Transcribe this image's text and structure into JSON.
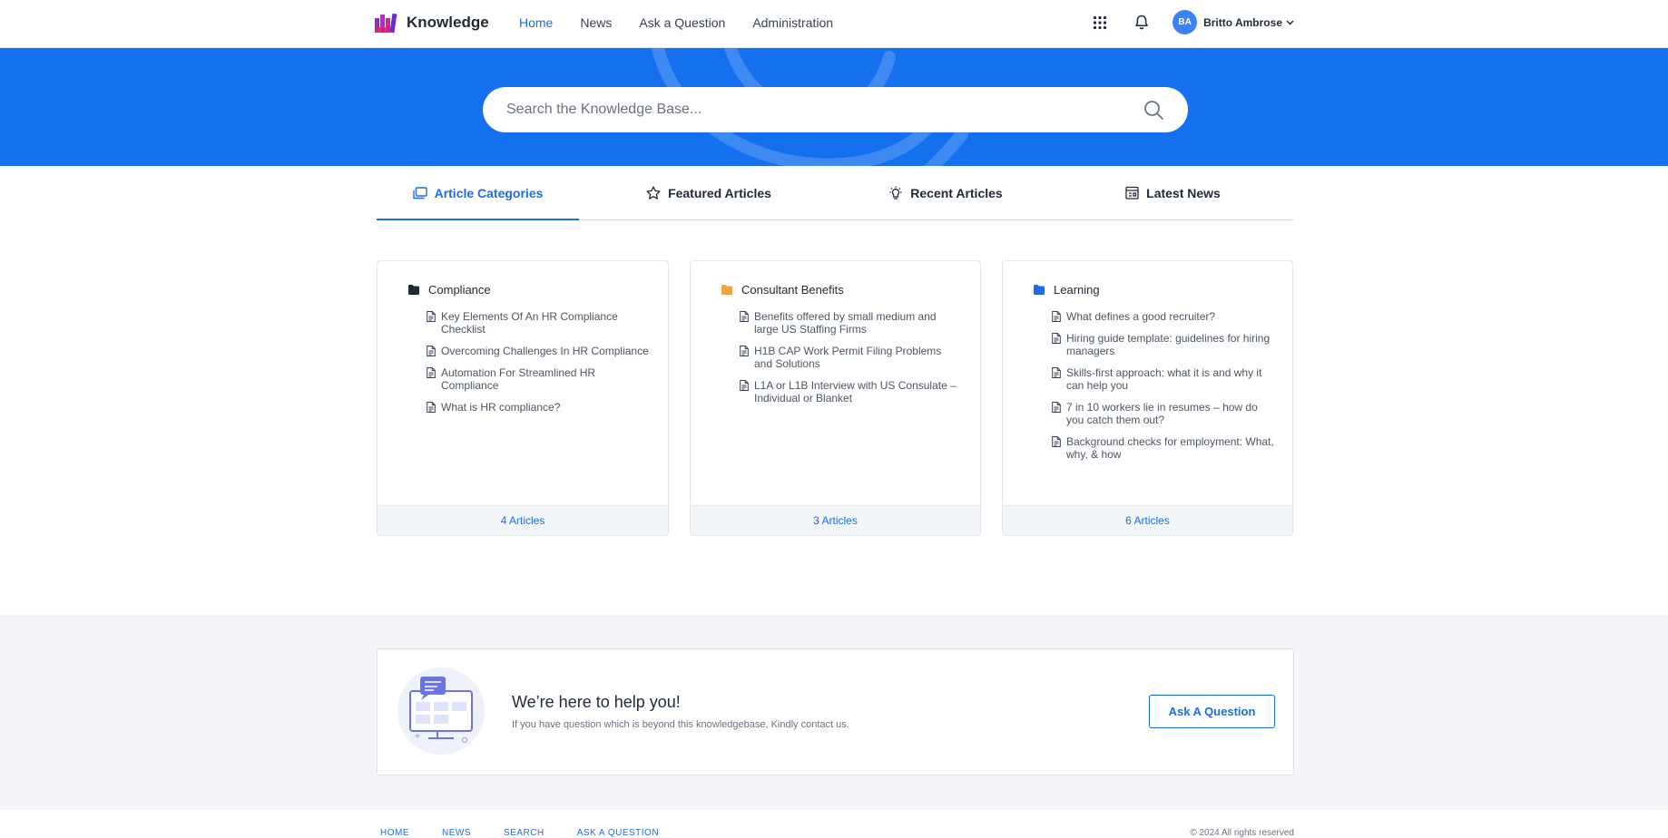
{
  "header": {
    "brand": "Knowledge",
    "nav": [
      "Home",
      "News",
      "Ask a Question",
      "Administration"
    ],
    "active_nav": "Home",
    "user": {
      "initials": "BA",
      "name": "Britto Ambrose"
    }
  },
  "hero": {
    "search_placeholder": "Search the Knowledge Base..."
  },
  "tabs": [
    "Article Categories",
    "Featured Articles",
    "Recent Articles",
    "Latest News"
  ],
  "categories": [
    {
      "name": "Compliance",
      "folder_color": "#1f2937",
      "articles": [
        "Key Elements Of An HR Compliance Checklist",
        "Overcoming Challenges In HR Compliance",
        "Automation For Streamlined HR Compliance",
        "What is HR compliance?"
      ],
      "count_label": "4 Articles"
    },
    {
      "name": "Consultant Benefits",
      "folder_color": "#f59e42",
      "articles": [
        "Benefits offered by small medium and large US Staffing Firms",
        "H1B CAP Work Permit Filing Problems and Solutions",
        "L1A or L1B Interview with US Consulate – Individual or Blanket"
      ],
      "count_label": "3 Articles"
    },
    {
      "name": "Learning",
      "folder_color": "#1a6ce8",
      "articles": [
        "What defines a good recruiter?",
        "Hiring guide template: guidelines for hiring managers",
        "Skills-first approach: what it is and why it can help you",
        "7 in 10 workers lie in resumes – how do you catch them out?",
        "Background checks for employment: What, why, & how"
      ],
      "count_label": "6 Articles"
    }
  ],
  "help": {
    "title": "We’re here to help you!",
    "subtitle": "If you have question which is beyond this knowledgebase, Kindly contact us.",
    "button": "Ask A Question"
  },
  "footer": {
    "links": [
      "HOME",
      "NEWS",
      "SEARCH",
      "ASK A QUESTION"
    ],
    "copyright": "© 2024 All rights reserved"
  },
  "colors": {
    "primary": "#1570ef",
    "accent_text": "#1a6ce8"
  }
}
